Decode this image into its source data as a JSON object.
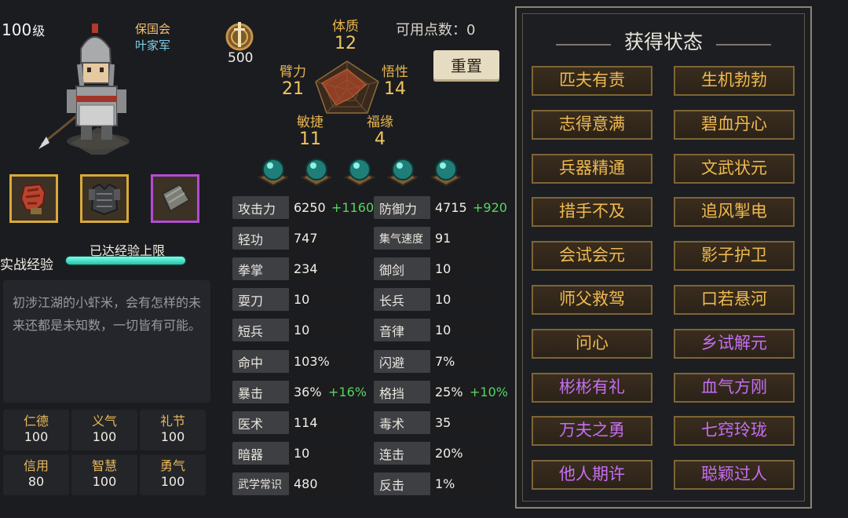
{
  "character": {
    "level": "100",
    "level_unit": "级",
    "faction": "保国会",
    "army": "叶家军"
  },
  "experience": {
    "label": "实战经验",
    "status": "已达经验上限",
    "progress": 1.0
  },
  "description": "初涉江湖的小虾米，会有怎样的未来还都是未知数，一切皆有可能。",
  "virtues": [
    {
      "name": "仁德",
      "value": "100"
    },
    {
      "name": "义气",
      "value": "100"
    },
    {
      "name": "礼节",
      "value": "100"
    },
    {
      "name": "信用",
      "value": "80"
    },
    {
      "name": "智慧",
      "value": "100"
    },
    {
      "name": "勇气",
      "value": "100"
    }
  ],
  "currency": {
    "value": "500",
    "icon": "sword-coin-icon"
  },
  "available_points": {
    "label": "可用点数：",
    "value": "0"
  },
  "reset_label": "重置",
  "attributes": {
    "tizhi": {
      "name": "体质",
      "value": "12"
    },
    "wuxing": {
      "name": "悟性",
      "value": "14"
    },
    "fuyuan": {
      "name": "福缘",
      "value": "4"
    },
    "minjie": {
      "name": "敏捷",
      "value": "11"
    },
    "bili": {
      "name": "臂力",
      "value": "21"
    }
  },
  "stats_left": [
    {
      "name": "攻击力",
      "value": "6250",
      "bonus": "+1160"
    },
    {
      "name": "轻功",
      "value": "747"
    },
    {
      "name": "拳掌",
      "value": "234"
    },
    {
      "name": "耍刀",
      "value": "10"
    },
    {
      "name": "短兵",
      "value": "10"
    },
    {
      "name": "命中",
      "value": "103%"
    },
    {
      "name": "暴击",
      "value": "36%",
      "bonus": "+16%"
    },
    {
      "name": "医术",
      "value": "114"
    },
    {
      "name": "暗器",
      "value": "10"
    },
    {
      "name": "武学常识",
      "value": "480"
    }
  ],
  "stats_right": [
    {
      "name": "防御力",
      "value": "4715",
      "bonus": "+920"
    },
    {
      "name": "集气速度",
      "value": "91"
    },
    {
      "name": "御剑",
      "value": "10"
    },
    {
      "name": "长兵",
      "value": "10"
    },
    {
      "name": "音律",
      "value": "10"
    },
    {
      "name": "闪避",
      "value": "7%"
    },
    {
      "name": "格挡",
      "value": "25%",
      "bonus": "+10%"
    },
    {
      "name": "毒术",
      "value": "35"
    },
    {
      "name": "连击",
      "value": "20%"
    },
    {
      "name": "反击",
      "value": "1%"
    }
  ],
  "status_panel": {
    "title": "获得状态",
    "items": [
      {
        "label": "匹夫有责",
        "color": "gold"
      },
      {
        "label": "生机勃勃",
        "color": "gold"
      },
      {
        "label": "志得意满",
        "color": "gold"
      },
      {
        "label": "碧血丹心",
        "color": "gold"
      },
      {
        "label": "兵器精通",
        "color": "gold"
      },
      {
        "label": "文武状元",
        "color": "gold"
      },
      {
        "label": "措手不及",
        "color": "gold"
      },
      {
        "label": "追风掣电",
        "color": "gold"
      },
      {
        "label": "会试会元",
        "color": "gold"
      },
      {
        "label": "影子护卫",
        "color": "gold"
      },
      {
        "label": "师父救驾",
        "color": "gold"
      },
      {
        "label": "口若悬河",
        "color": "gold"
      },
      {
        "label": "问心",
        "color": "gold"
      },
      {
        "label": "乡试解元",
        "color": "purple"
      },
      {
        "label": "彬彬有礼",
        "color": "purple"
      },
      {
        "label": "血气方刚",
        "color": "purple"
      },
      {
        "label": "万夫之勇",
        "color": "purple"
      },
      {
        "label": "七窍玲珑",
        "color": "purple"
      },
      {
        "label": "他人期许",
        "color": "purple"
      },
      {
        "label": "聪颖过人",
        "color": "purple"
      }
    ]
  },
  "colors": {
    "accent_gold": "#efba4f",
    "accent_purple": "#c66ef2",
    "bonus_green": "#56d65e",
    "exp_bar": "#3fe0c8"
  }
}
